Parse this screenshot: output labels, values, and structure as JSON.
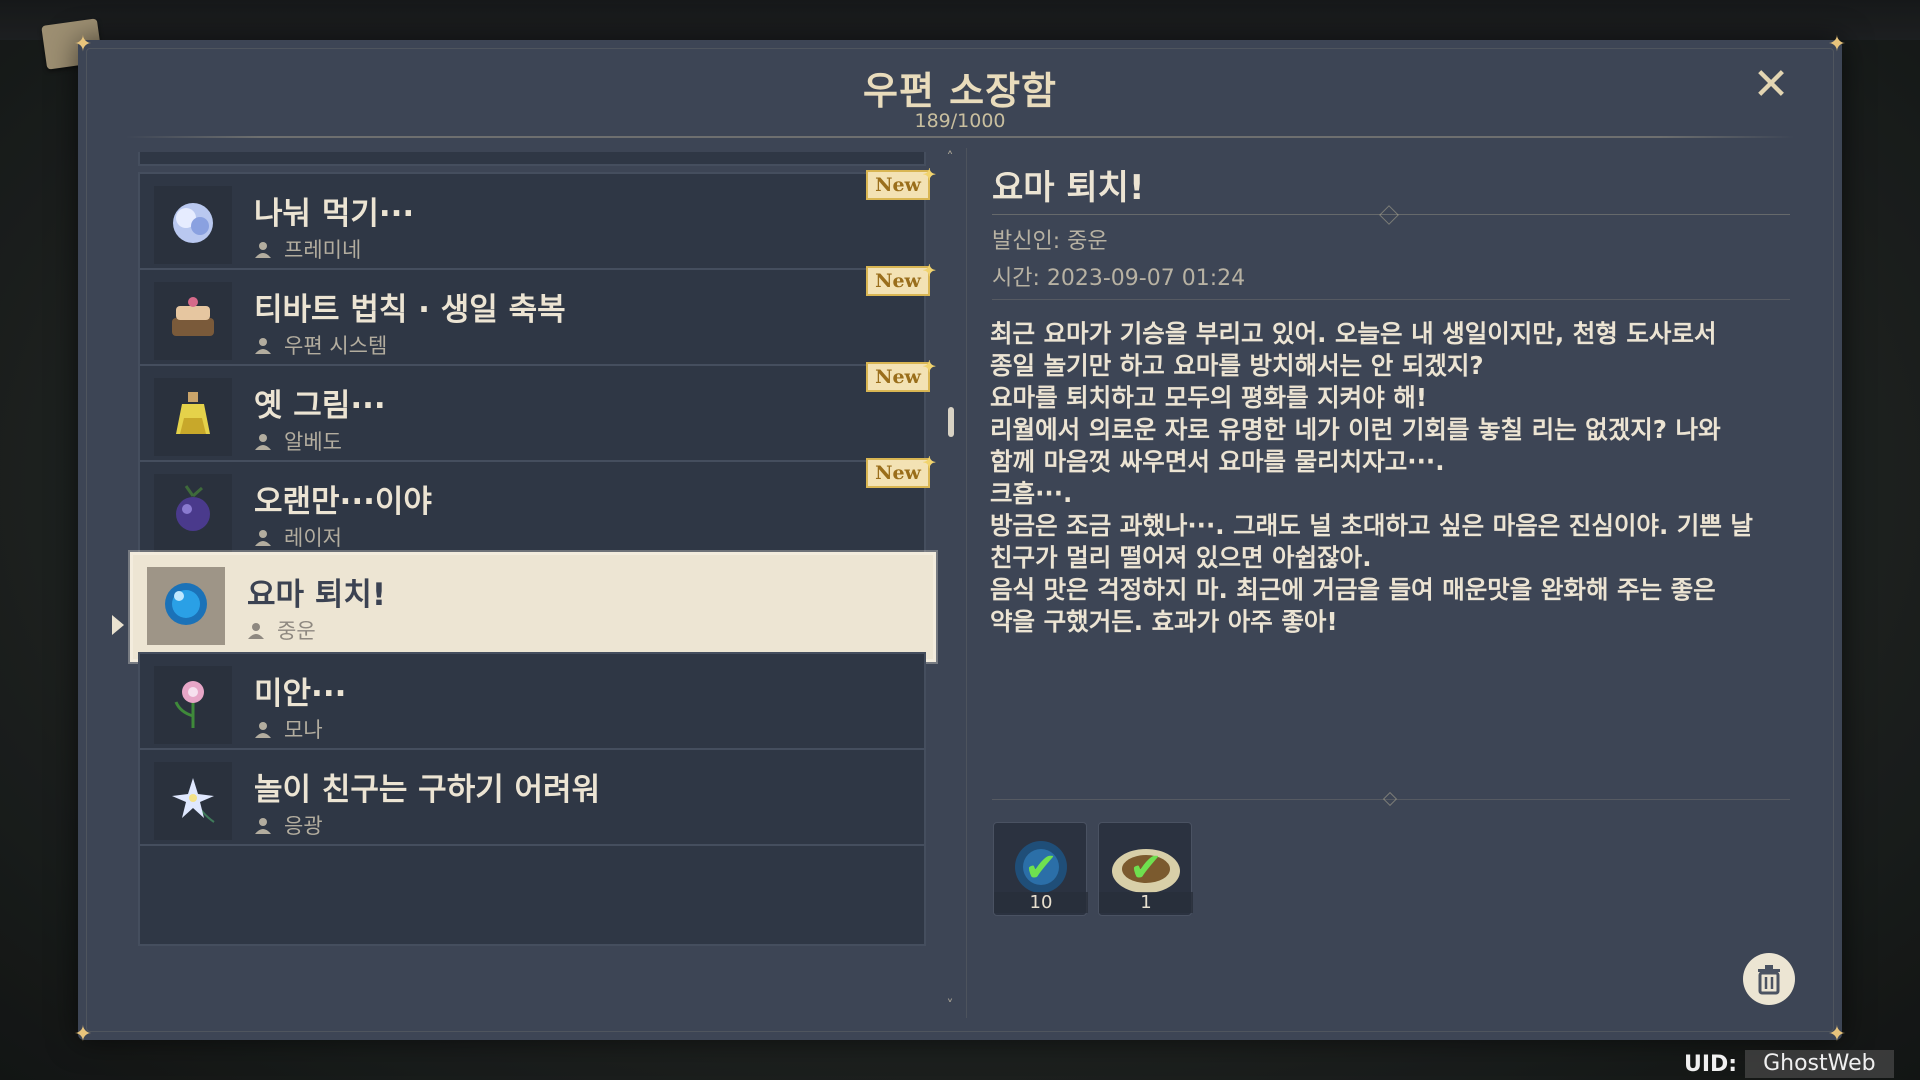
{
  "window": {
    "title": "우편 소장함",
    "count": "189/1000",
    "close_icon": "close-icon"
  },
  "mail_list": [
    {
      "subject": "나눠 먹기···",
      "sender": "프레미네",
      "is_new": true,
      "badge": "New",
      "icon": "pearl-flower-icon",
      "selected": false
    },
    {
      "subject": "티바트 법칙 · 생일 축복",
      "sender": "우편 시스템",
      "is_new": true,
      "badge": "New",
      "icon": "cake-icon",
      "selected": false
    },
    {
      "subject": "옛 그림···",
      "sender": "알베도",
      "is_new": true,
      "badge": "New",
      "icon": "potion-icon",
      "selected": false
    },
    {
      "subject": "오랜만···이야",
      "sender": "레이저",
      "is_new": true,
      "badge": "New",
      "icon": "berry-icon",
      "selected": false
    },
    {
      "subject": "요마 퇴치!",
      "sender": "중운",
      "is_new": false,
      "badge": "",
      "icon": "blue-orb-icon",
      "selected": true
    },
    {
      "subject": "미안···",
      "sender": "모나",
      "is_new": false,
      "badge": "",
      "icon": "flower-icon",
      "selected": false
    },
    {
      "subject": "놀이 친구는 구하기 어려워",
      "sender": "응광",
      "is_new": false,
      "badge": "",
      "icon": "glaze-lily-icon",
      "selected": false
    }
  ],
  "detail": {
    "title": "요마 퇴치!",
    "sender_line": "발신인: 중운",
    "time_line": "시간: 2023-09-07 01:24",
    "body_lines": [
      "최근 요마가 기승을 부리고 있어. 오늘은 내 생일이지만, 천형 도사로서",
      "종일 놀기만 하고 요마를 방치해서는 안 되겠지?",
      "요마를 퇴치하고 모두의 평화를 지켜야 해!",
      "리월에서 의로운 자로 유명한 네가 이런 기회를 놓칠 리는 없겠지? 나와",
      "함께 마음껏 싸우면서 요마를 물리치자고···.",
      "크흠···.",
      "방금은 조금 과했나···. 그래도 널 초대하고 싶은 마음은 진심이야. 기쁜 날",
      "친구가 멀리 떨어져 있으면 아쉽잖아.",
      "음식 맛은 걱정하지 마. 최근에 거금을 들여 매운맛을 완화해 주는 좋은",
      "약을 구했거든. 효과가 아주 좋아!"
    ],
    "rewards": [
      {
        "icon": "intertwined-fate-icon",
        "count": "10",
        "claimed": true
      },
      {
        "icon": "dish-icon",
        "count": "1",
        "claimed": true
      }
    ]
  },
  "delete_icon": "trash-icon",
  "uid": {
    "label": "UID:",
    "value": "GhostWeb"
  },
  "colors": {
    "panel": "#3d4555",
    "item_bg": "#2f3745",
    "selected_bg": "#ede5d3",
    "title_text": "#e9dcbc",
    "badge_bg": "#f3e2b4",
    "badge_border": "#d9b653",
    "claimed_check": "#6fe04f"
  }
}
